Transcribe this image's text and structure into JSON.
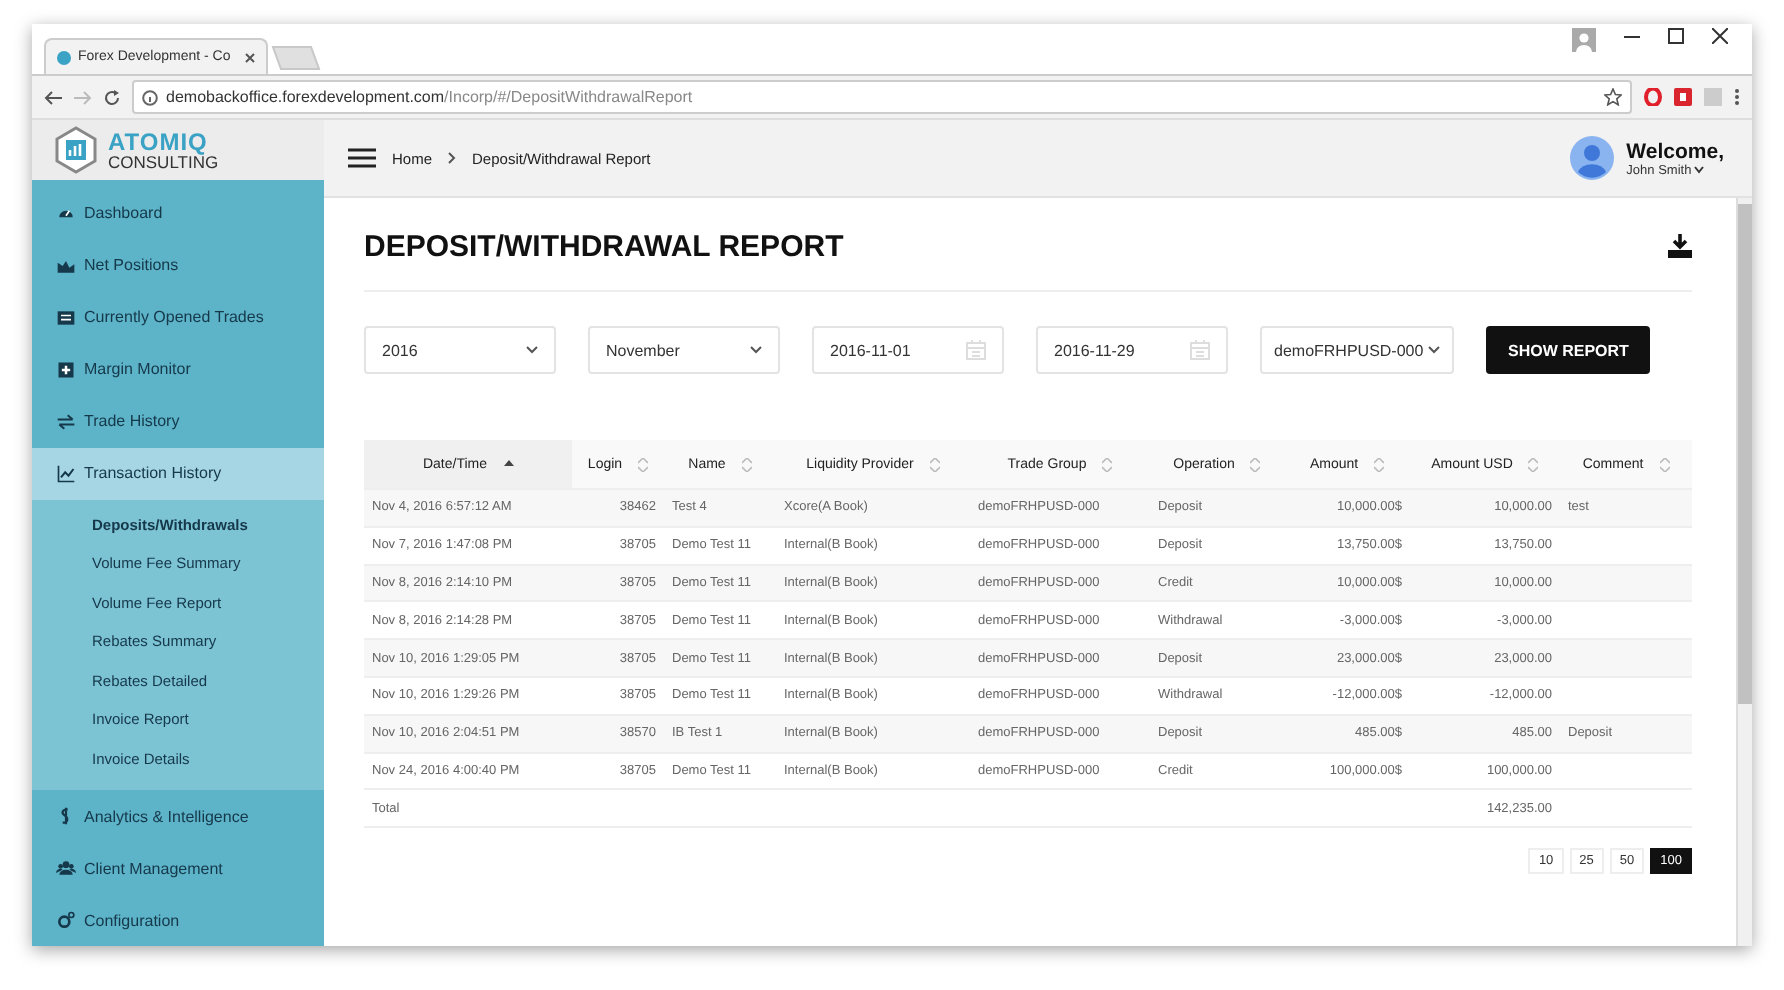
{
  "browser": {
    "tab_title": "Forex Development - Co",
    "url_host": "demobackoffice.forexdevelopment.com",
    "url_path": "/Incorp/#/DepositWithdrawalReport"
  },
  "header": {
    "logo": {
      "line1": "ATOMIQ",
      "line2": "CONSULTING"
    },
    "breadcrumb": [
      "Home",
      "Deposit/Withdrawal Report"
    ],
    "user": {
      "greeting": "Welcome,",
      "name": "John Smith"
    }
  },
  "sidebar": {
    "items": [
      {
        "label": "Dashboard",
        "selected": false
      },
      {
        "label": "Net Positions",
        "selected": false
      },
      {
        "label": "Currently Opened Trades",
        "selected": false
      },
      {
        "label": "Margin Monitor",
        "selected": false
      },
      {
        "label": "Trade History",
        "selected": false
      },
      {
        "label": "Transaction History",
        "selected": true,
        "expanded": true,
        "children": [
          {
            "label": "Deposits/Withdrawals",
            "selected": true
          },
          {
            "label": "Volume Fee Summary",
            "selected": false
          },
          {
            "label": "Volume Fee Report",
            "selected": false
          },
          {
            "label": "Rebates Summary",
            "selected": false
          },
          {
            "label": "Rebates Detailed",
            "selected": false
          },
          {
            "label": "Invoice Report",
            "selected": false
          },
          {
            "label": "Invoice Details",
            "selected": false
          }
        ]
      },
      {
        "label": "Analytics & Intelligence",
        "selected": false
      },
      {
        "label": "Client Management",
        "selected": false
      },
      {
        "label": "Configuration",
        "selected": false
      }
    ]
  },
  "page": {
    "title": "DEPOSIT/WITHDRAWAL REPORT",
    "filters": [
      {
        "kind": "select",
        "value": "2016"
      },
      {
        "kind": "select",
        "value": "November"
      },
      {
        "kind": "date",
        "value": "2016-11-01"
      },
      {
        "kind": "date",
        "value": "2016-11-29"
      },
      {
        "kind": "select",
        "value": "demoFRHPUSD-000"
      }
    ],
    "show_button": "SHOW REPORT"
  },
  "table": {
    "columns": [
      {
        "label": "Date/Time",
        "sorted": true
      },
      {
        "label": "Login",
        "sorted": false
      },
      {
        "label": "Name",
        "sorted": false
      },
      {
        "label": "Liquidity Provider",
        "sorted": false
      },
      {
        "label": "Trade Group",
        "sorted": false
      },
      {
        "label": "Operation",
        "sorted": false
      },
      {
        "label": "Amount",
        "sorted": false
      },
      {
        "label": "Amount USD",
        "sorted": false
      },
      {
        "label": "Comment",
        "sorted": false
      }
    ],
    "rows": [
      [
        "Nov 4, 2016 6:57:12 AM",
        "38462",
        "Test 4",
        "Xcore(A Book)",
        "demoFRHPUSD-000",
        "Deposit",
        "10,000.00$",
        "10,000.00",
        "test"
      ],
      [
        "Nov 7, 2016 1:47:08 PM",
        "38705",
        "Demo Test 11",
        "Internal(B Book)",
        "demoFRHPUSD-000",
        "Deposit",
        "13,750.00$",
        "13,750.00",
        ""
      ],
      [
        "Nov 8, 2016 2:14:10 PM",
        "38705",
        "Demo Test 11",
        "Internal(B Book)",
        "demoFRHPUSD-000",
        "Credit",
        "10,000.00$",
        "10,000.00",
        ""
      ],
      [
        "Nov 8, 2016 2:14:28 PM",
        "38705",
        "Demo Test 11",
        "Internal(B Book)",
        "demoFRHPUSD-000",
        "Withdrawal",
        "-3,000.00$",
        "-3,000.00",
        ""
      ],
      [
        "Nov 10, 2016 1:29:05 PM",
        "38705",
        "Demo Test 11",
        "Internal(B Book)",
        "demoFRHPUSD-000",
        "Deposit",
        "23,000.00$",
        "23,000.00",
        ""
      ],
      [
        "Nov 10, 2016 1:29:26 PM",
        "38705",
        "Demo Test 11",
        "Internal(B Book)",
        "demoFRHPUSD-000",
        "Withdrawal",
        "-12,000.00$",
        "-12,000.00",
        ""
      ],
      [
        "Nov 10, 2016 2:04:51 PM",
        "38570",
        "IB Test 1",
        "Internal(B Book)",
        "demoFRHPUSD-000",
        "Deposit",
        "485.00$",
        "485.00",
        "Deposit"
      ],
      [
        "Nov 24, 2016 4:00:40 PM",
        "38705",
        "Demo Test 11",
        "Internal(B Book)",
        "demoFRHPUSD-000",
        "Credit",
        "100,000.00$",
        "100,000.00",
        ""
      ]
    ],
    "total": {
      "label": "Total",
      "amount_usd": "142,235.00"
    }
  },
  "page_sizes": [
    {
      "label": "10",
      "selected": false
    },
    {
      "label": "25",
      "selected": false
    },
    {
      "label": "50",
      "selected": false
    },
    {
      "label": "100",
      "selected": true
    }
  ]
}
